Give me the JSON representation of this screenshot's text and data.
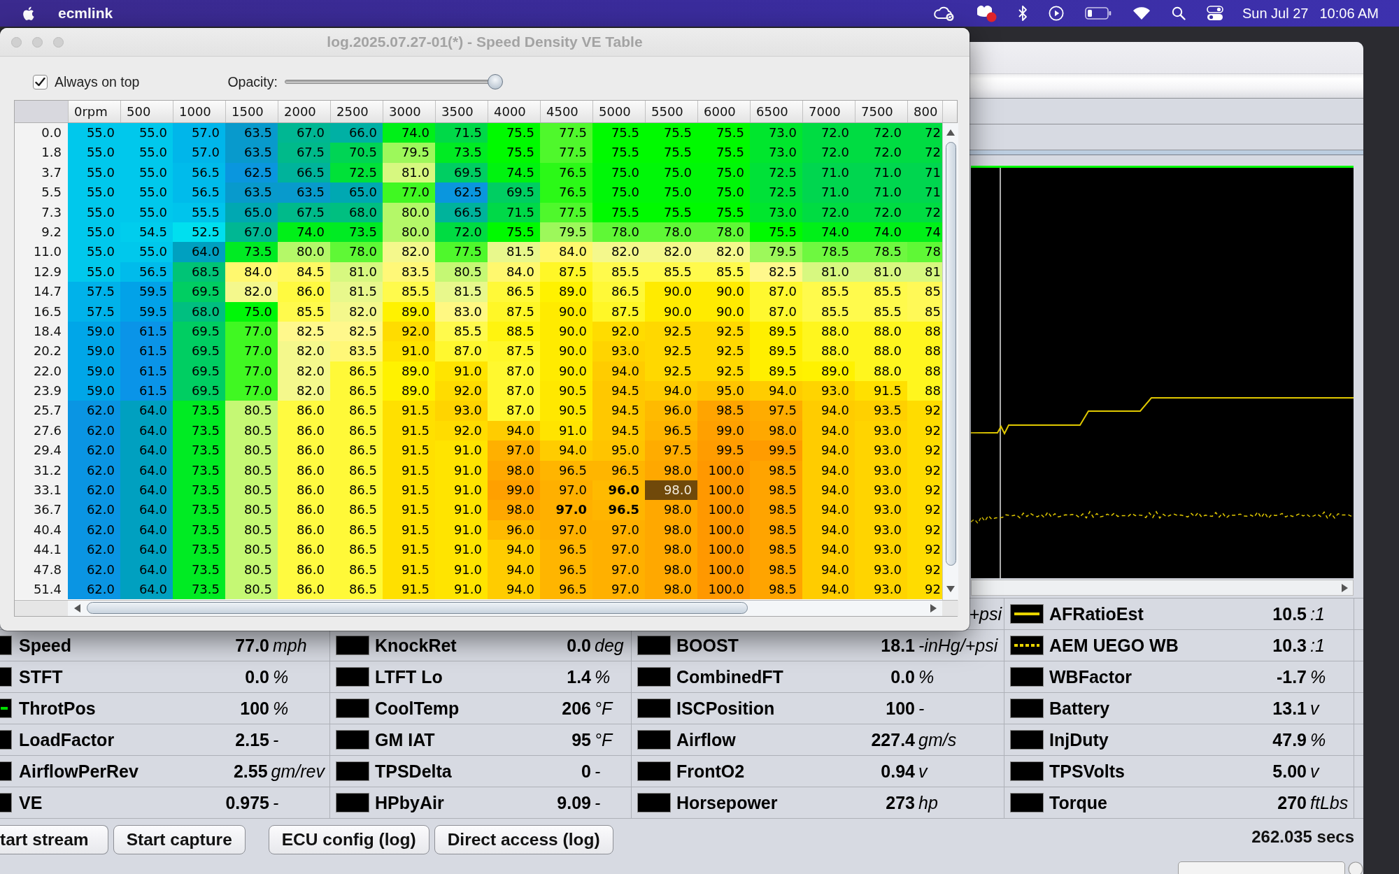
{
  "menu_bar": {
    "app_name": "ecmlink",
    "date": "Sun Jul 27",
    "time": "10:06 AM"
  },
  "ve_table_window": {
    "title": "log.2025.07.27-01(*) - Speed Density VE Table",
    "always_on_top": {
      "label": "Always on top",
      "checked": true
    },
    "opacity": {
      "label": "Opacity:",
      "level": 1.0
    },
    "table": {
      "columns": [
        "0rpm",
        "500",
        "1000",
        "1500",
        "2000",
        "2500",
        "3000",
        "3500",
        "4000",
        "4500",
        "5000",
        "5500",
        "6000",
        "6500",
        "7000",
        "7500",
        "800"
      ],
      "rows": [
        {
          "label": "0.0",
          "cells": [
            "55.0",
            "55.0",
            "57.0",
            "63.5",
            "67.0",
            "66.0",
            "74.0",
            "71.5",
            "75.5",
            "77.5",
            "75.5",
            "75.5",
            "75.5",
            "73.0",
            "72.0",
            "72.0",
            "72"
          ]
        },
        {
          "label": "1.8",
          "cells": [
            "55.0",
            "55.0",
            "57.0",
            "63.5",
            "67.5",
            "70.5",
            "79.5",
            "73.5",
            "75.5",
            "77.5",
            "75.5",
            "75.5",
            "75.5",
            "73.0",
            "72.0",
            "72.0",
            "72"
          ]
        },
        {
          "label": "3.7",
          "cells": [
            "55.0",
            "55.0",
            "56.5",
            "62.5",
            "66.5",
            "72.5",
            "81.0",
            "69.5",
            "74.5",
            "76.5",
            "75.0",
            "75.0",
            "75.0",
            "72.5",
            "71.0",
            "71.0",
            "71"
          ]
        },
        {
          "label": "5.5",
          "cells": [
            "55.0",
            "55.0",
            "56.5",
            "63.5",
            "63.5",
            "65.0",
            "77.0",
            "62.5",
            "69.5",
            "76.5",
            "75.0",
            "75.0",
            "75.0",
            "72.5",
            "71.0",
            "71.0",
            "71"
          ]
        },
        {
          "label": "7.3",
          "cells": [
            "55.0",
            "55.0",
            "55.5",
            "65.0",
            "67.5",
            "68.0",
            "80.0",
            "66.5",
            "71.5",
            "77.5",
            "75.5",
            "75.5",
            "75.5",
            "73.0",
            "72.0",
            "72.0",
            "72"
          ]
        },
        {
          "label": "9.2",
          "cells": [
            "55.0",
            "54.5",
            "52.5",
            "67.0",
            "74.0",
            "73.5",
            "80.0",
            "72.0",
            "75.5",
            "79.5",
            "78.0",
            "78.0",
            "78.0",
            "75.5",
            "74.0",
            "74.0",
            "74"
          ]
        },
        {
          "label": "11.0",
          "cells": [
            "55.0",
            "55.0",
            "64.0",
            "73.5",
            "80.0",
            "78.0",
            "82.0",
            "77.5",
            "81.5",
            "84.0",
            "82.0",
            "82.0",
            "82.0",
            "79.5",
            "78.5",
            "78.5",
            "78"
          ]
        },
        {
          "label": "12.9",
          "cells": [
            "55.0",
            "56.5",
            "68.5",
            "84.0",
            "84.5",
            "81.0",
            "83.5",
            "80.5",
            "84.0",
            "87.5",
            "85.5",
            "85.5",
            "85.5",
            "82.5",
            "81.0",
            "81.0",
            "81"
          ]
        },
        {
          "label": "14.7",
          "cells": [
            "57.5",
            "59.5",
            "69.5",
            "82.0",
            "86.0",
            "81.5",
            "85.5",
            "81.5",
            "86.5",
            "89.0",
            "86.5",
            "90.0",
            "90.0",
            "87.0",
            "85.5",
            "85.5",
            "85"
          ]
        },
        {
          "label": "16.5",
          "cells": [
            "57.5",
            "59.5",
            "68.0",
            "75.0",
            "85.5",
            "82.0",
            "89.0",
            "83.0",
            "87.5",
            "90.0",
            "87.5",
            "90.0",
            "90.0",
            "87.0",
            "85.5",
            "85.5",
            "85"
          ]
        },
        {
          "label": "18.4",
          "cells": [
            "59.0",
            "61.5",
            "69.5",
            "77.0",
            "82.5",
            "82.5",
            "92.0",
            "85.5",
            "88.5",
            "90.0",
            "92.0",
            "92.5",
            "92.5",
            "89.5",
            "88.0",
            "88.0",
            "88"
          ]
        },
        {
          "label": "20.2",
          "cells": [
            "59.0",
            "61.5",
            "69.5",
            "77.0",
            "82.0",
            "83.5",
            "91.0",
            "87.0",
            "87.5",
            "90.0",
            "93.0",
            "92.5",
            "92.5",
            "89.5",
            "88.0",
            "88.0",
            "88"
          ]
        },
        {
          "label": "22.0",
          "cells": [
            "59.0",
            "61.5",
            "69.5",
            "77.0",
            "82.0",
            "86.5",
            "89.0",
            "91.0",
            "87.0",
            "90.0",
            "94.0",
            "92.5",
            "92.5",
            "89.5",
            "89.0",
            "88.0",
            "88"
          ]
        },
        {
          "label": "23.9",
          "cells": [
            "59.0",
            "61.5",
            "69.5",
            "77.0",
            "82.0",
            "86.5",
            "89.0",
            "92.0",
            "87.0",
            "90.5",
            "94.5",
            "94.0",
            "95.0",
            "94.0",
            "93.0",
            "91.5",
            "88"
          ]
        },
        {
          "label": "25.7",
          "cells": [
            "62.0",
            "64.0",
            "73.5",
            "80.5",
            "86.0",
            "86.5",
            "91.5",
            "93.0",
            "87.0",
            "90.5",
            "94.5",
            "96.0",
            "98.5",
            "97.5",
            "94.0",
            "93.5",
            "92"
          ]
        },
        {
          "label": "27.6",
          "cells": [
            "62.0",
            "64.0",
            "73.5",
            "80.5",
            "86.0",
            "86.5",
            "91.5",
            "92.0",
            "94.0",
            "91.0",
            "94.5",
            "96.5",
            "99.0",
            "98.0",
            "94.0",
            "93.0",
            "92"
          ]
        },
        {
          "label": "29.4",
          "cells": [
            "62.0",
            "64.0",
            "73.5",
            "80.5",
            "86.0",
            "86.5",
            "91.5",
            "91.0",
            "97.0",
            "94.0",
            "95.0",
            "97.5",
            "99.5",
            "99.5",
            "94.0",
            "93.0",
            "92"
          ]
        },
        {
          "label": "31.2",
          "cells": [
            "62.0",
            "64.0",
            "73.5",
            "80.5",
            "86.0",
            "86.5",
            "91.5",
            "91.0",
            "98.0",
            "96.5",
            "96.5",
            "98.0",
            "100.0",
            "98.5",
            "94.0",
            "93.0",
            "92"
          ]
        },
        {
          "label": "33.1",
          "cells": [
            "62.0",
            "64.0",
            "73.5",
            "80.5",
            "86.0",
            "86.5",
            "91.5",
            "91.0",
            "99.0",
            "97.0",
            {
              "value": "96.0",
              "kind": "trail"
            },
            {
              "value": "98.0",
              "kind": "cursor"
            },
            "100.0",
            "98.5",
            "94.0",
            "93.0",
            "92"
          ]
        },
        {
          "label": "36.7",
          "cells": [
            "62.0",
            "64.0",
            "73.5",
            "80.5",
            "86.0",
            "86.5",
            "91.5",
            "91.0",
            "98.0",
            {
              "value": "97.0",
              "kind": "trail"
            },
            {
              "value": "96.5",
              "kind": "trail"
            },
            "98.0",
            "100.0",
            "98.5",
            "94.0",
            "93.0",
            "92"
          ]
        },
        {
          "label": "40.4",
          "cells": [
            "62.0",
            "64.0",
            "73.5",
            "80.5",
            "86.0",
            "86.5",
            "91.5",
            "91.0",
            "96.0",
            "97.0",
            "97.0",
            "98.0",
            "100.0",
            "98.5",
            "94.0",
            "93.0",
            "92"
          ]
        },
        {
          "label": "44.1",
          "cells": [
            "62.0",
            "64.0",
            "73.5",
            "80.5",
            "86.0",
            "86.5",
            "91.5",
            "91.0",
            "94.0",
            "96.5",
            "97.0",
            "98.0",
            "100.0",
            "98.5",
            "94.0",
            "93.0",
            "92"
          ]
        },
        {
          "label": "47.8",
          "cells": [
            "62.0",
            "64.0",
            "73.5",
            "80.5",
            "86.0",
            "86.5",
            "91.5",
            "91.0",
            "94.0",
            "96.5",
            "97.0",
            "98.0",
            "100.0",
            "98.5",
            "94.0",
            "93.0",
            "92"
          ]
        },
        {
          "label": "51.4",
          "cells": [
            "62.0",
            "64.0",
            "73.5",
            "80.5",
            "86.0",
            "86.5",
            "91.5",
            "91.0",
            "94.0",
            "96.5",
            "97.0",
            "98.0",
            "100.0",
            "98.5",
            "94.0",
            "93.0",
            "92"
          ]
        }
      ]
    }
  },
  "main_window": {
    "gauge_rows": [
      [
        {
          "unit": "+psi"
        },
        {
          "name": "AFRatioEst",
          "value": "10.5",
          "unit": ":1",
          "color": "#e8d400",
          "dashed": false
        }
      ],
      [
        {
          "name": "Speed",
          "value": "77.0",
          "unit": "mph"
        },
        {
          "name": "KnockRet",
          "value": "0.0",
          "unit": "deg"
        },
        {
          "name": "BOOST",
          "value": "18.1",
          "unit": "-inHg/+psi"
        },
        {
          "name": "AEM UEGO WB",
          "value": "10.3",
          "unit": ":1",
          "color": "#e8d400",
          "dashed": true
        }
      ],
      [
        {
          "name": "STFT",
          "value": "0.0",
          "unit": "%"
        },
        {
          "name": "LTFT Lo",
          "value": "1.4",
          "unit": "%"
        },
        {
          "name": "CombinedFT",
          "value": "0.0",
          "unit": "%"
        },
        {
          "name": "WBFactor",
          "value": "-1.7",
          "unit": "%"
        }
      ],
      [
        {
          "name": "ThrotPos",
          "value": "100",
          "unit": "%",
          "color": "#00dd00",
          "dashed": false
        },
        {
          "name": "CoolTemp",
          "value": "206",
          "unit": "°F"
        },
        {
          "name": "ISCPosition",
          "value": "100",
          "unit": "-"
        },
        {
          "name": "Battery",
          "value": "13.1",
          "unit": "v"
        }
      ],
      [
        {
          "name": "LoadFactor",
          "value": "2.15",
          "unit": "-"
        },
        {
          "name": "GM IAT",
          "value": "95",
          "unit": "°F"
        },
        {
          "name": "Airflow",
          "value": "227.4",
          "unit": "gm/s"
        },
        {
          "name": "InjDuty",
          "value": "47.9",
          "unit": "%"
        }
      ],
      [
        {
          "name": "AirflowPerRev",
          "value": "2.55",
          "unit": "gm/rev"
        },
        {
          "name": "TPSDelta",
          "value": "0",
          "unit": "-"
        },
        {
          "name": "FrontO2",
          "value": "0.94",
          "unit": "v"
        },
        {
          "name": "TPSVolts",
          "value": "5.00",
          "unit": "v"
        }
      ],
      [
        {
          "name": "VE",
          "value": "0.975",
          "unit": "-"
        },
        {
          "name": "HPbyAir",
          "value": "9.09",
          "unit": "-"
        },
        {
          "name": "Horsepower",
          "value": "273",
          "unit": "hp"
        },
        {
          "name": "Torque",
          "value": "270",
          "unit": "ftLbs"
        }
      ]
    ],
    "buttons": [
      "tart stream",
      "Start capture",
      "ECU config (log)",
      "Direct access (log)"
    ],
    "elapsed": "262.035 secs"
  }
}
